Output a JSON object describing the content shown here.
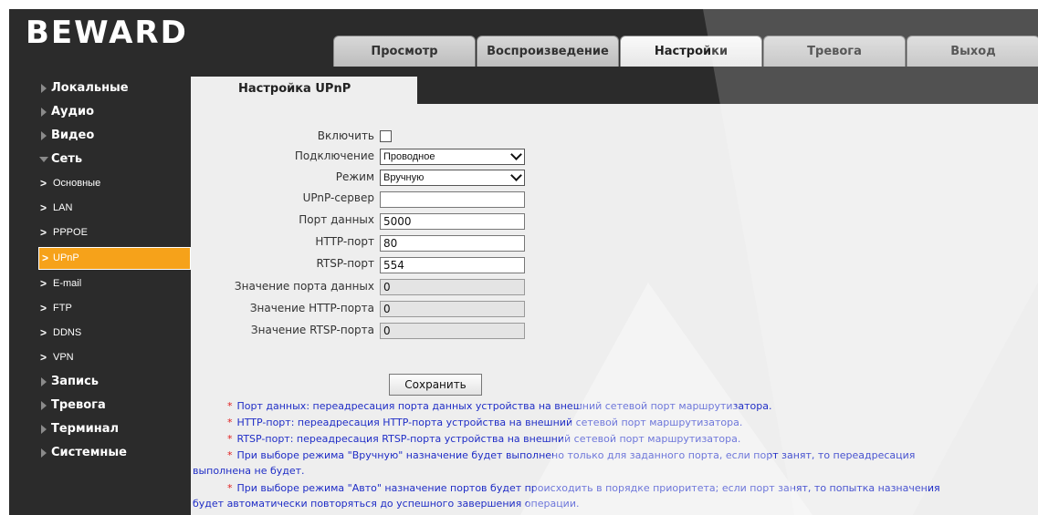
{
  "brand": {
    "logo_text": "BEWARD"
  },
  "top_tabs": [
    {
      "label": "Просмотр"
    },
    {
      "label": "Воспроизведение"
    },
    {
      "label": "Настройки"
    },
    {
      "label": "Тревога"
    },
    {
      "label": "Выход"
    }
  ],
  "sidebar": {
    "items": [
      {
        "label": "Локальные"
      },
      {
        "label": "Аудио"
      },
      {
        "label": "Видео"
      },
      {
        "label": "Сеть"
      },
      {
        "label": "Запись"
      },
      {
        "label": "Тревога"
      },
      {
        "label": "Терминал"
      },
      {
        "label": "Системные"
      }
    ],
    "network_sub": [
      {
        "label": "Основные"
      },
      {
        "label": "LAN"
      },
      {
        "label": "PPPOE"
      },
      {
        "label": "UPnP"
      },
      {
        "label": "E-mail"
      },
      {
        "label": "FTP"
      },
      {
        "label": "DDNS"
      },
      {
        "label": "VPN"
      }
    ],
    "chevron": ">"
  },
  "section": {
    "title": "Настройка UPnP"
  },
  "form": {
    "enable_label": "Включить",
    "connection_label": "Подключение",
    "connection_value": "Проводное",
    "mode_label": "Режим",
    "mode_value": "Вручную",
    "server_label": "UPnP-сервер",
    "server_value": "",
    "data_port_label": "Порт данных",
    "data_port_value": "5000",
    "http_port_label": "HTTP-порт",
    "http_port_value": "80",
    "rtsp_port_label": "RTSP-порт",
    "rtsp_port_value": "554",
    "data_port_status_label": "Значение порта данных",
    "data_port_status_value": "0",
    "http_port_status_label": "Значение HTTP-порта",
    "http_port_status_value": "0",
    "rtsp_port_status_label": "Значение RTSP-порта",
    "rtsp_port_status_value": "0",
    "save_label": "Сохранить"
  },
  "notes": {
    "star": "*",
    "n1": "Порт данных: переадресация порта данных устройства на внешний сетевой порт маршрутизатора.",
    "n2": "HTTP-порт: переадресация HTTP-порта устройства на внешний сетевой порт маршрутизатора.",
    "n3": "RTSP-порт: переадресация RTSP-порта устройства на внешний сетевой порт маршрутизатора.",
    "n4a": "При выборе режима \"Вручную\" назначение будет выполнено только для заданного порта, если порт занят, то переадресация",
    "n4b": "выполнена не будет.",
    "n5a": "При выборе режима \"Авто\" назначение портов будет происходить в порядке приоритета; если порт занят, то попытка назначения",
    "n5b": "будет автоматически повторяться до успешного завершения операции."
  },
  "colors": {
    "accent": "#f6a21a",
    "note_text": "#1f2dc6",
    "note_star": "#e02020",
    "background": "#2b2b2b"
  }
}
